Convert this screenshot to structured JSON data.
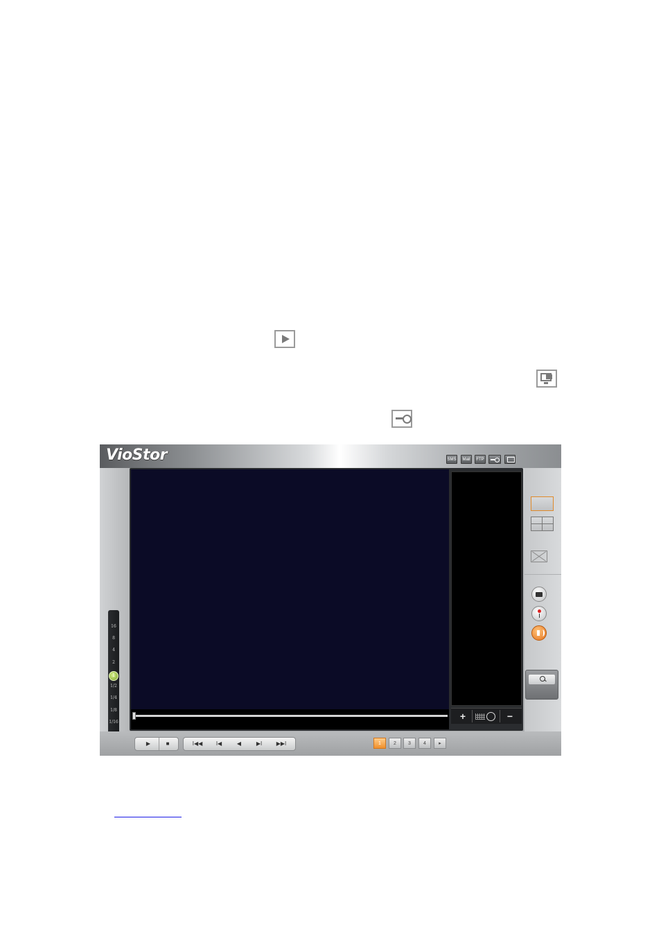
{
  "app": {
    "logo": "VioStor",
    "toolbar": {
      "sms": "SMS",
      "mail": "Mail",
      "ftp": "FTP"
    },
    "speed_options": [
      "16",
      "8",
      "4",
      "2",
      "1",
      "1/2",
      "1/4",
      "1/8",
      "1/16"
    ],
    "selected_speed": "1",
    "timeline_position": 0,
    "playback": {
      "play": "▶",
      "stop": "■"
    },
    "navigation": {
      "first": "I◀◀",
      "prev_frame": "I◀",
      "reverse": "◀",
      "next_frame": "▶I",
      "last": "▶▶I"
    },
    "side_controls": {
      "zoom_in": "+",
      "zoom_out": "−"
    },
    "pages": [
      "1",
      "2",
      "3",
      "4"
    ],
    "page_next": "▸",
    "active_page": "1",
    "colors": {
      "accent": "#f0902c",
      "video_bg": "#0b0b26"
    }
  },
  "doc_icons": [
    "play-icon",
    "monitor-icon",
    "key-icon"
  ],
  "link_color": "#1a1ae6"
}
